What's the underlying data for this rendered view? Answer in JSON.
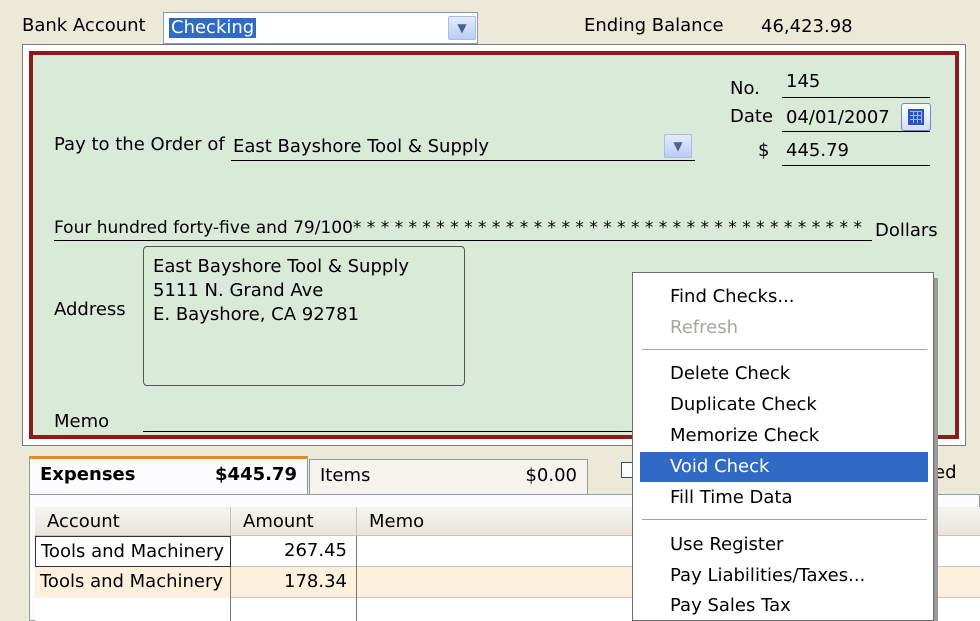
{
  "header": {
    "bank_account_label": "Bank Account",
    "bank_account_value": "Checking",
    "ending_balance_label": "Ending Balance",
    "ending_balance_value": "46,423.98"
  },
  "check": {
    "no_label": "No.",
    "no_value": "145",
    "date_label": "Date",
    "date_value": "04/01/2007",
    "dollar_sign": "$",
    "amount": "445.79",
    "pay_to_label": "Pay to the Order of",
    "payee": "East Bayshore Tool & Supply",
    "amount_words": "Four hundred forty-five and 79/100* * * * * * * * * * * * * * * * * * * * * * * * * * * * * * * * * * * * *",
    "dollars_label": "Dollars",
    "address_label": "Address",
    "address_lines": [
      "East Bayshore Tool & Supply",
      "5111 N. Grand Ave",
      "E. Bayshore,  CA  92781"
    ],
    "memo_label": "Memo"
  },
  "tabs": {
    "expenses_label": "Expenses",
    "expenses_total": "$445.79",
    "items_label": "Items",
    "items_total": "$0.00",
    "right_fragment": "ed"
  },
  "grid": {
    "columns": [
      "Account",
      "Amount",
      "Memo"
    ],
    "rows": [
      {
        "account": "Tools and Machinery",
        "amount": "267.45",
        "memo": ""
      },
      {
        "account": "Tools and Machinery",
        "amount": "178.34",
        "memo": ""
      }
    ]
  },
  "context_menu": {
    "items": [
      {
        "label": "Find Checks...",
        "enabled": true
      },
      {
        "label": "Refresh",
        "enabled": false
      },
      {
        "label": "Delete Check",
        "enabled": true
      },
      {
        "label": "Duplicate Check",
        "enabled": true
      },
      {
        "label": "Memorize Check",
        "enabled": true
      },
      {
        "label": "Void Check",
        "enabled": true,
        "highlighted": true
      },
      {
        "label": "Fill Time Data",
        "enabled": true
      },
      {
        "label": "Use Register",
        "enabled": true
      },
      {
        "label": "Pay Liabilities/Taxes...",
        "enabled": true
      },
      {
        "label": "Pay Sales Tax",
        "enabled": true
      }
    ]
  },
  "colors": {
    "check_background": "#d9ead9",
    "check_border": "#8b1c1c",
    "selection": "#316ac5",
    "active_tab_accent": "#e68b2c"
  },
  "icons": [
    "chevron-down-icon",
    "calendar-icon"
  ]
}
